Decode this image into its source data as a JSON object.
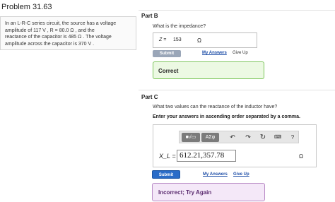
{
  "problem": {
    "title": "Problem 31.63",
    "text_lines": [
      "In an L-R-C series circuit, the source has a voltage",
      "amplitude of 117 V , R = 80.0 Ω , and the",
      "reactance of the capacitor is 485 Ω . The voltage",
      "amplitude across the capacitor is 370 V ."
    ]
  },
  "part_b": {
    "heading": "Part B",
    "question": "What is the impedance?",
    "answer_label": "Z =",
    "answer_value": "153",
    "answer_unit": "Ω",
    "submit_label": "Submit",
    "my_answers_label": "My Answers",
    "give_up_label": "Give Up",
    "feedback": "Correct"
  },
  "part_c": {
    "heading": "Part C",
    "question": "What two values can the reactance of the inductor have?",
    "instruction": "Enter your answers in ascending order separated by a comma.",
    "toolbar": {
      "template_label": "■√▭",
      "greek_label": "ΑΣφ",
      "undo_icon": "↶",
      "redo_icon": "↷",
      "reset_icon": "↻",
      "keyboard_icon": "⌨",
      "help_icon": "?"
    },
    "answer_label": "X_L =",
    "answer_value": "612.21,357.78",
    "answer_unit": "Ω",
    "submit_label": "Submit",
    "my_answers_label": "My Answers",
    "give_up_label": "Give Up",
    "feedback": "Incorrect; Try Again"
  },
  "colors": {
    "correct_bg": "#ecf9e3",
    "correct_border": "#7cc55b",
    "incorrect_bg": "#f4e8f8",
    "incorrect_border": "#b98bc6",
    "submit_active": "#2a6cc8",
    "submit_disabled": "#9aa6b8",
    "link": "#1f4fa8"
  }
}
